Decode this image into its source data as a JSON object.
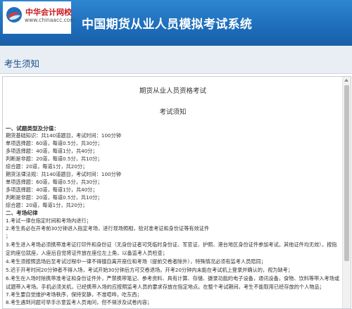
{
  "header": {
    "logo_cn": "中华会计网校",
    "logo_url": "www.chinaacc.com",
    "system_title": "中国期货从业人员模拟考试系统"
  },
  "section": {
    "title": "考生须知"
  },
  "notice": {
    "exam_name": "期货从业人员资格考试",
    "notice_title": "考试须知",
    "lines": [
      "一、试题类型及分值：",
      "期货基础知识：共140道题目，考试时间：100分钟",
      "单项选择题：60道，每道0.5分，共30分；",
      "多项选择题：40道，每道1分，共40分；",
      "判断是非题：20道，每道0.5分，共10分；",
      "综合题：20道，每道1分，共20分；",
      "期货法律法规：共140道题目，考试时间：100分钟",
      "单项选择题：60道，每道0.5分，共30分；",
      "多项选择题：40道，每道1分，共40分；",
      "判断是非题：20道，每道0.5分，共10分；",
      "综合题：20道，每道1分，共20分；",
      "二、考场纪律",
      "1.考试一律在指定时间和考场内进行；",
      "2.考生务必在开考前30分钟进入指定考场，进行现场照相，验对准考证和身份证等有效证件",
      "；",
      "3.考生进入考场必须携带准考证打印件和身份证（无身份证者可凭临时身份证、军官证、护照、港台地区身份证件参加考试，其他证件均无效），按指定的座位就座，入座后自觉将证件放在座位左上角，以备监考人员检查；",
      "4.考生须按照选场后至考试过程中一律不得擅自离开座位和考场（提前交卷者除外），特殊情况必须有监考人员陪同；",
      "5.迟于开考时间20分钟者不得入场，考试开始30分钟后方可交卷退场。开考20分钟内未能在考试机上登录并确认的，视为缺考；",
      "6.考生在入场时除携带准考证和身份证件外，严禁携带笔记、参考资料、具有计算、存储、摄录功能的电子设备，通讯设备，食物、饮料等带入考场或试题带入考场。手机必须关机，已经携带入场的应按照监考人员的要求存放在指定地点。在整个考试期间，考生不能取用已经存放的个人物品；",
      "7.考生要自觉维护考场秩序，保持安静，不准喧哗，吃东西；",
      "8.考生遇到问题可举手示意监考人员询问，但不得涉及试卷内容；"
    ]
  }
}
